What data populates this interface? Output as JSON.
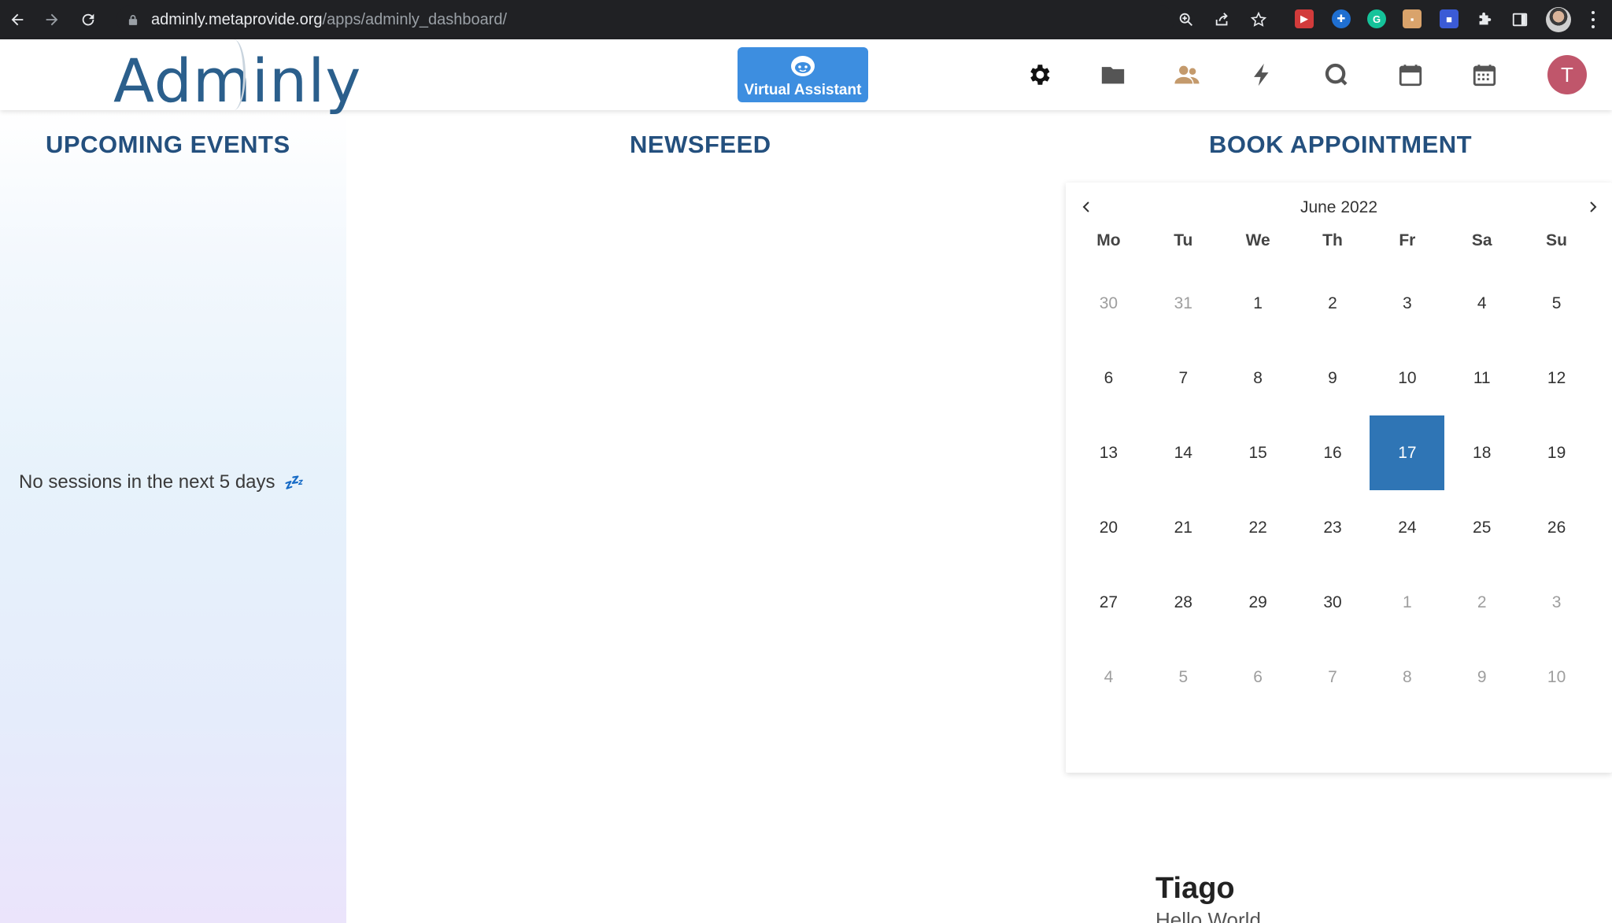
{
  "browser": {
    "url_host": "adminly.metaprovide.org",
    "url_path": "/apps/adminly_dashboard/"
  },
  "header": {
    "logo_text": "Adminly",
    "virtual_assistant_label": "Virtual Assistant",
    "nav_icons": [
      "gear-icon",
      "folder-icon",
      "users-icon",
      "lightning-icon",
      "search-icon",
      "calendar-icon",
      "calendar-grid-icon"
    ],
    "avatar_initial": "T",
    "colors": {
      "brand": "#2b5f8c",
      "va_button": "#3d8ee0",
      "avatar": "#c0566b",
      "users_icon": "#c49a6c"
    }
  },
  "sections": {
    "upcoming_events": {
      "title": "UPCOMING EVENTS",
      "empty_text": "No sessions in the next 5 days",
      "empty_icon": "zzz-sleep-icon"
    },
    "newsfeed": {
      "title": "NEWSFEED"
    },
    "book_appointment": {
      "title": "BOOK APPOINTMENT"
    }
  },
  "calendar": {
    "month_label": "June 2022",
    "weekdays": [
      "Mo",
      "Tu",
      "We",
      "Th",
      "Fr",
      "Sa",
      "Su"
    ],
    "selected_day": "17",
    "selected_color": "#2f75b5",
    "weeks": [
      [
        {
          "d": "30",
          "m": true
        },
        {
          "d": "31",
          "m": true
        },
        {
          "d": "1"
        },
        {
          "d": "2"
        },
        {
          "d": "3"
        },
        {
          "d": "4"
        },
        {
          "d": "5"
        }
      ],
      [
        {
          "d": "6"
        },
        {
          "d": "7"
        },
        {
          "d": "8"
        },
        {
          "d": "9"
        },
        {
          "d": "10"
        },
        {
          "d": "11"
        },
        {
          "d": "12"
        }
      ],
      [
        {
          "d": "13"
        },
        {
          "d": "14"
        },
        {
          "d": "15"
        },
        {
          "d": "16"
        },
        {
          "d": "17",
          "s": true
        },
        {
          "d": "18"
        },
        {
          "d": "19"
        }
      ],
      [
        {
          "d": "20"
        },
        {
          "d": "21"
        },
        {
          "d": "22"
        },
        {
          "d": "23"
        },
        {
          "d": "24"
        },
        {
          "d": "25"
        },
        {
          "d": "26"
        }
      ],
      [
        {
          "d": "27"
        },
        {
          "d": "28"
        },
        {
          "d": "29"
        },
        {
          "d": "30"
        },
        {
          "d": "1",
          "m": true
        },
        {
          "d": "2",
          "m": true
        },
        {
          "d": "3",
          "m": true
        }
      ],
      [
        {
          "d": "4",
          "m": true
        },
        {
          "d": "5",
          "m": true
        },
        {
          "d": "6",
          "m": true
        },
        {
          "d": "7",
          "m": true
        },
        {
          "d": "8",
          "m": true
        },
        {
          "d": "9",
          "m": true
        },
        {
          "d": "10",
          "m": true
        }
      ]
    ]
  },
  "profile": {
    "name": "Tiago",
    "status": "Hello World"
  }
}
